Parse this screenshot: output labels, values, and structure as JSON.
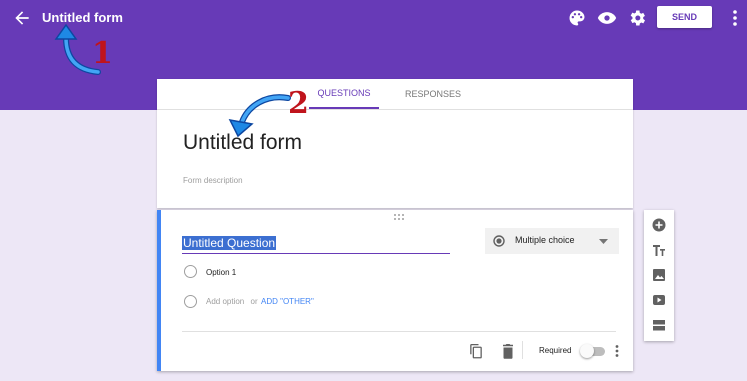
{
  "header": {
    "title": "Untitled form",
    "send_label": "SEND",
    "icons": [
      "back-arrow-icon",
      "palette-icon",
      "eye-icon",
      "gear-icon",
      "more-vert-icon"
    ]
  },
  "annotations": {
    "marker_1": "1",
    "marker_2": "2"
  },
  "tabs": [
    {
      "label": "QUESTIONS",
      "active": true
    },
    {
      "label": "RESPONSES",
      "active": false
    }
  ],
  "form": {
    "title": "Untitled form",
    "description_placeholder": "Form description"
  },
  "question": {
    "title": "Untitled Question",
    "type": "Multiple choice",
    "options": [
      "Option 1"
    ],
    "add_option": "Add option",
    "or": "or",
    "add_other": "ADD \"OTHER\"",
    "required_label": "Required",
    "required": false
  },
  "side_toolbar": [
    "add-question-icon",
    "add-title-icon",
    "add-image-icon",
    "add-video-icon",
    "add-section-icon"
  ],
  "colors": {
    "header": "#673ab7",
    "accent": "#4285f4",
    "background": "#ede7f6",
    "annotation_number": "#c0141c",
    "annotation_arrow": "#1e88e5"
  }
}
